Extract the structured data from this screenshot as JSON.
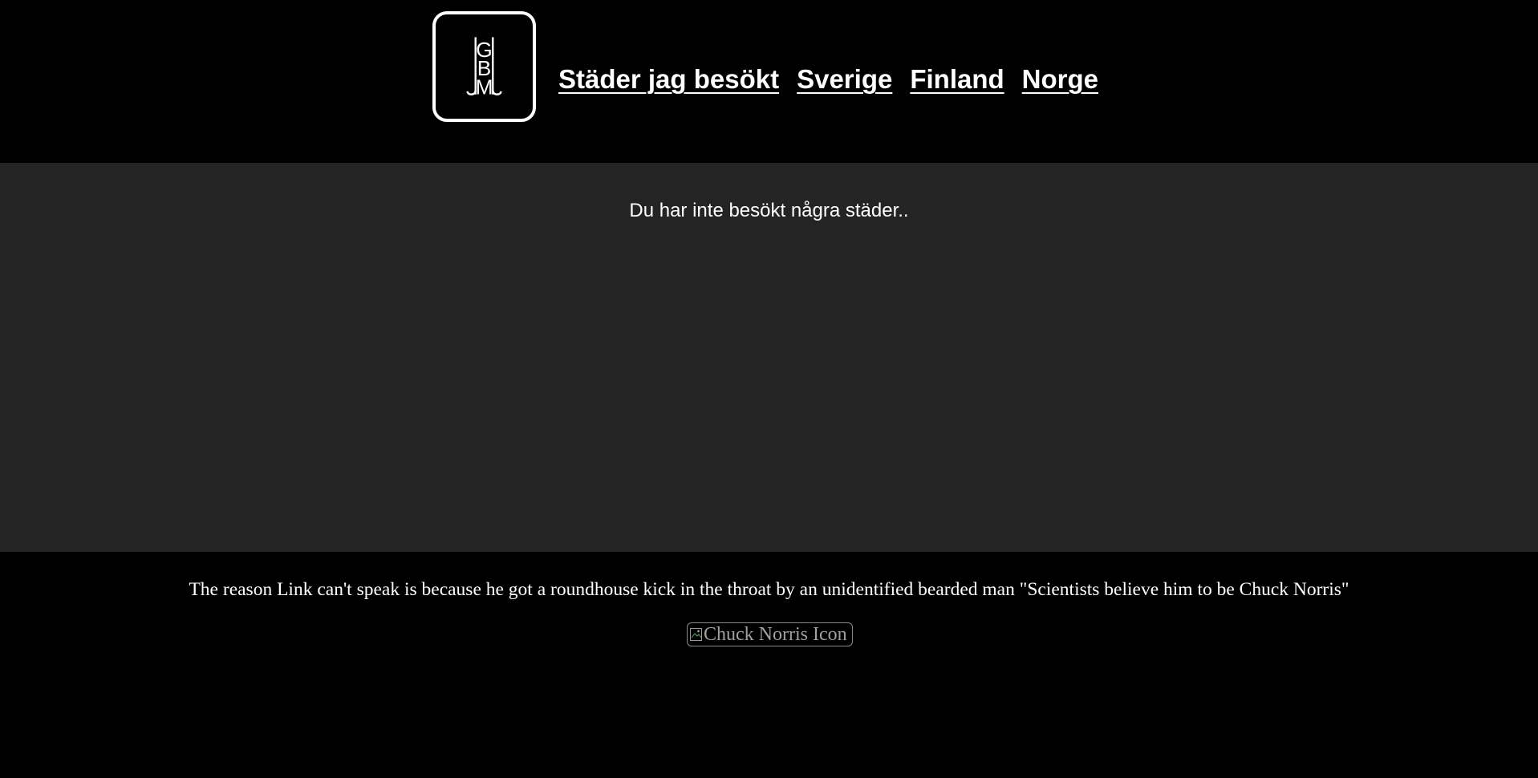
{
  "logo": {
    "letters": [
      "G",
      "B",
      "M"
    ]
  },
  "nav": {
    "items": [
      {
        "label": "Städer jag besökt"
      },
      {
        "label": "Sverige"
      },
      {
        "label": "Finland"
      },
      {
        "label": "Norge"
      }
    ]
  },
  "main": {
    "message": "Du har inte besökt några städer.."
  },
  "footer": {
    "joke": "The reason Link can't speak is because he got a roundhouse kick in the throat by an unidentified bearded man \"Scientists believe him to be Chuck Norris\"",
    "image_alt": "Chuck Norris Icon"
  },
  "colors": {
    "header_bg": "#000000",
    "main_bg": "#242424",
    "footer_bg": "#000000",
    "text": "#ffffff"
  }
}
